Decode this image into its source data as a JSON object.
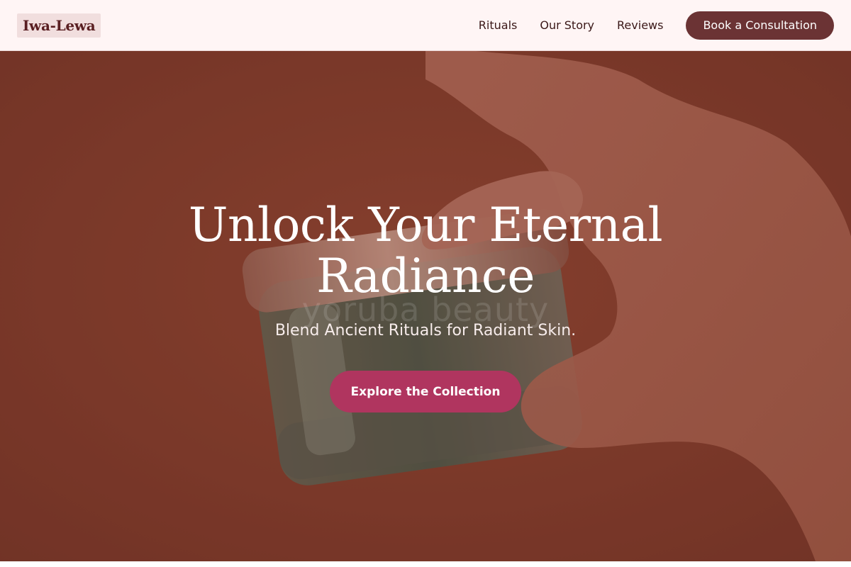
{
  "brand": {
    "logo_text": "Iwa-Lewa"
  },
  "nav": {
    "links": [
      {
        "label": "Rituals"
      },
      {
        "label": "Our Story"
      },
      {
        "label": "Reviews"
      }
    ],
    "cta_label": "Book a Consultation"
  },
  "hero": {
    "title_line1": "Unlock Your Eternal",
    "title_line2": "Radiance",
    "watermark": "yoruba beauty",
    "subtitle": "Blend Ancient Rituals for Radiant Skin.",
    "cta_label": "Explore the Collection",
    "image_description_icon": "hand-holding-jar-image"
  },
  "colors": {
    "nav_bg": "#fff5f5",
    "brand_dark": "#6b3334",
    "hero_bg": "#7b3a2b",
    "cta_pink": "#b0355f"
  }
}
